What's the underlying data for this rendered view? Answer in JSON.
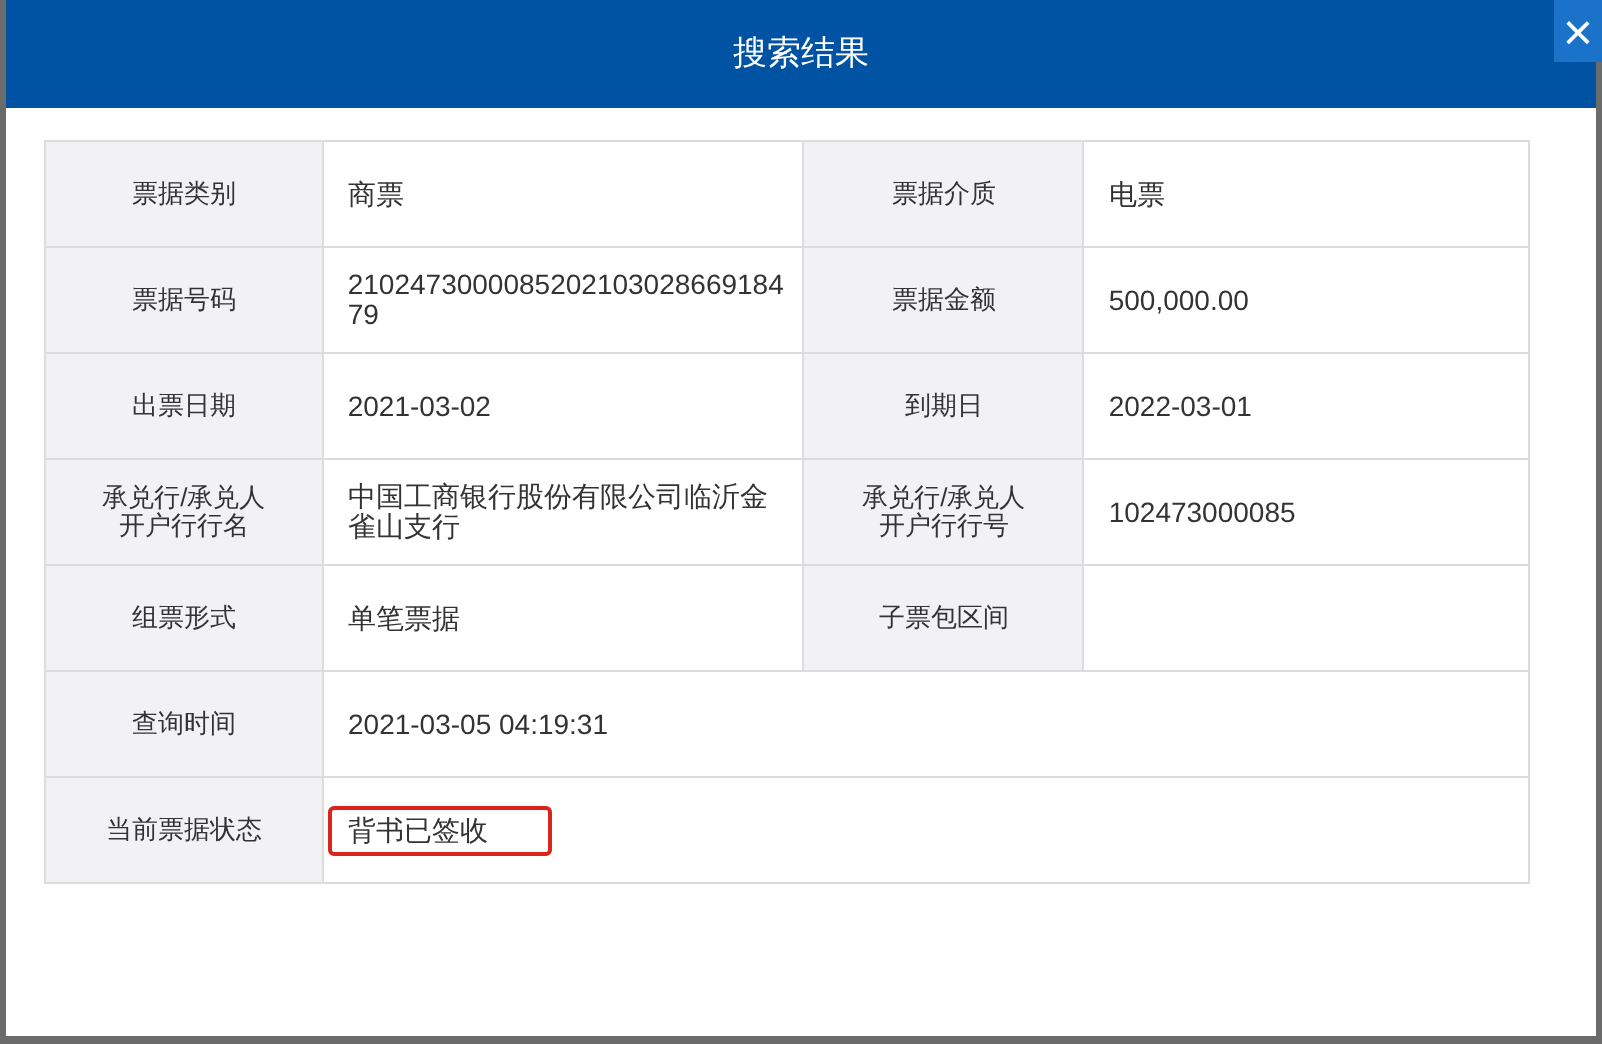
{
  "dialog": {
    "title": "搜索结果",
    "close": "×"
  },
  "rows": [
    {
      "fields": [
        {
          "label": "票据类别",
          "value": "商票"
        },
        {
          "label": "票据介质",
          "value": "电票"
        }
      ]
    },
    {
      "fields": [
        {
          "label": "票据号码",
          "value": "210247300008520210302866918479"
        },
        {
          "label": "票据金额",
          "value": "500,000.00"
        }
      ]
    },
    {
      "fields": [
        {
          "label": "出票日期",
          "value": "2021-03-02"
        },
        {
          "label": "到期日",
          "value": "2022-03-01"
        }
      ]
    },
    {
      "fields": [
        {
          "label": "承兑行/承兑人开户行行名",
          "value": "中国工商银行股份有限公司临沂金雀山支行"
        },
        {
          "label": "承兑行/承兑人开户行行号",
          "value": "102473000085"
        }
      ]
    },
    {
      "fields": [
        {
          "label": "组票形式",
          "value": "单笔票据"
        },
        {
          "label": "子票包区间"
        }
      ]
    },
    {
      "fields": [
        {
          "label": "查询时间",
          "value": "2021-03-05 04:19:31"
        }
      ]
    },
    {
      "fields": [
        {
          "label": "当前票据状态",
          "value": "背书已签收",
          "highlighted": true
        }
      ]
    }
  ]
}
